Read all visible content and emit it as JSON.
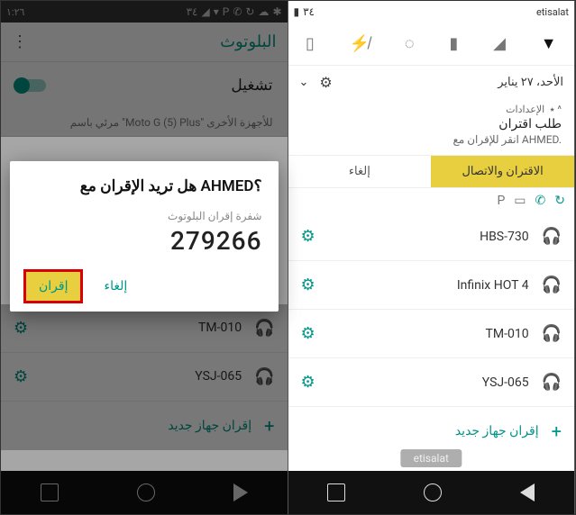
{
  "left": {
    "status": {
      "time": "١:٢٦",
      "battery_pct": "٣٤"
    },
    "header": {
      "title": "البلوتوث"
    },
    "toggle": {
      "label": "تشغيل"
    },
    "visible_as": "مرئي باسم \"Moto G (5) Plus\" للأجهزة الأخرى",
    "devices": [
      {
        "name": "TM-010"
      },
      {
        "name": "YSJ-065"
      }
    ],
    "pair_new": "إقران جهاز جديد",
    "dialog": {
      "title": "هل تريد الإقران مع AHMED؟",
      "sub": "شفرة إقران البلوتوث",
      "code": "279266",
      "cancel": "إلغاء",
      "pair": "إقران"
    }
  },
  "right": {
    "status": {
      "time": "٣٤",
      "carrier": "etisalat"
    },
    "date": "الأحد، ٢٧ يناير",
    "notif_src": "الإعدادات  ⁦ ⁦⁦٭⁩   ^",
    "notif_title": "طلب اقتران",
    "notif_sub": "انقر للإقران مع AHMED.",
    "notif_pair": "الاقتران والاتصال",
    "notif_cancel": "إلغاء",
    "devices": [
      {
        "name": "HBS-730"
      },
      {
        "name": "Infinix HOT 4"
      },
      {
        "name": "TM-010"
      },
      {
        "name": "YSJ-065"
      }
    ],
    "pair_new": "إقران جهاز جديد",
    "toast": "etisalat"
  }
}
